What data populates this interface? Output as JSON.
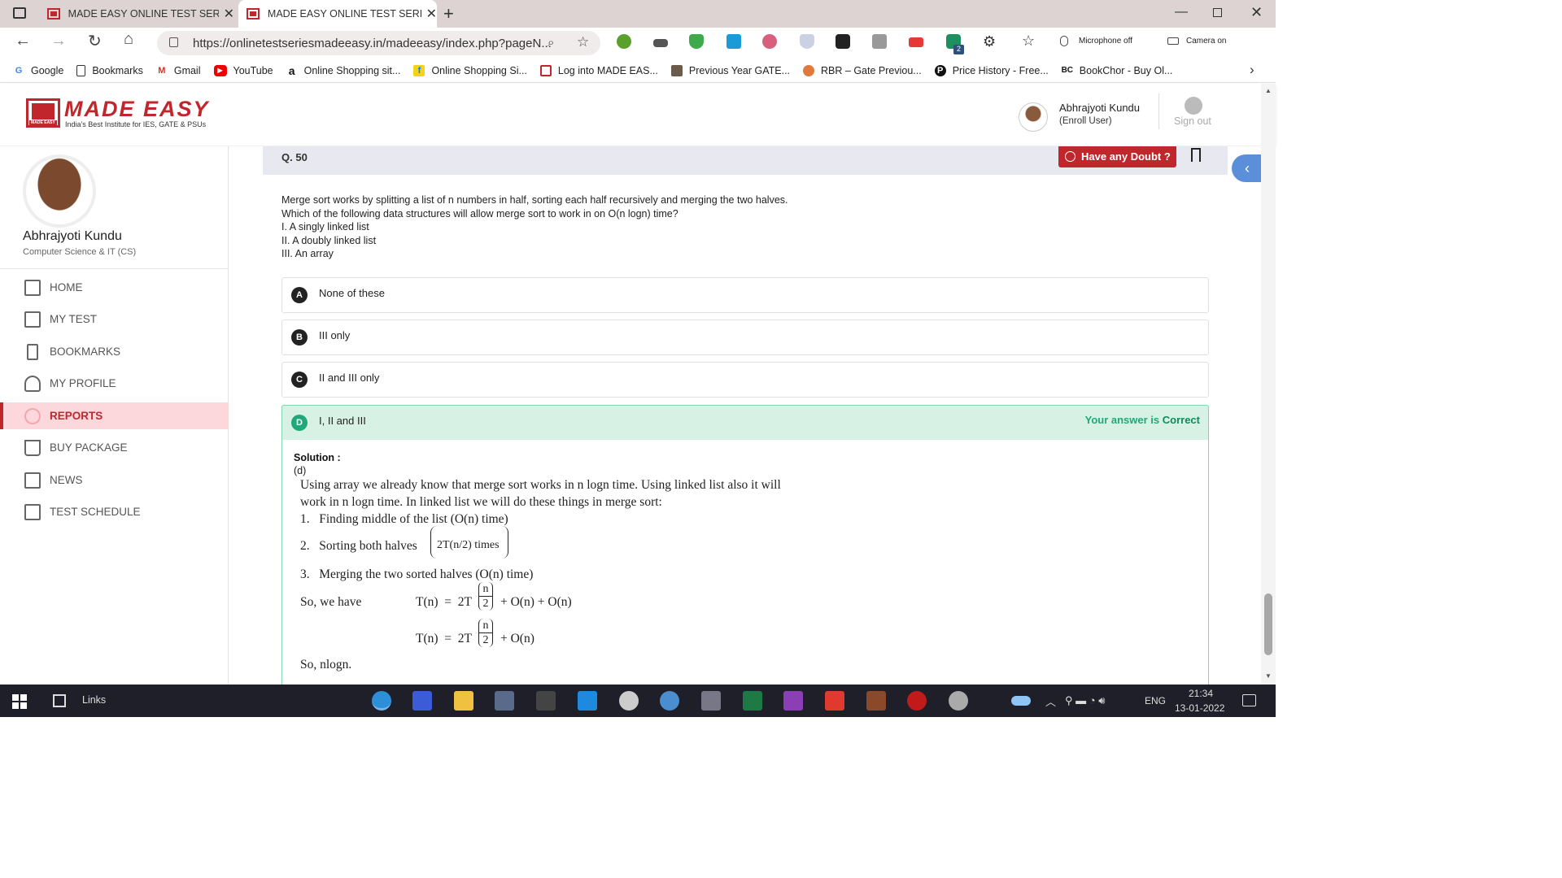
{
  "browser": {
    "tabs": [
      {
        "title": "MADE EASY ONLINE TEST SERIES",
        "active": false
      },
      {
        "title": "MADE EASY ONLINE TEST SERIES",
        "active": true
      }
    ],
    "url": "https://onlinetestseriesmadeeasy.in/madeeasy/index.php?pageN...",
    "mic_status": "Microphone off",
    "camera_status": "Camera on",
    "ext_badge": "2",
    "bookmarks": [
      {
        "label": "Google",
        "icon": "google-icon"
      },
      {
        "label": "Bookmarks",
        "icon": "page-icon"
      },
      {
        "label": "Gmail",
        "icon": "gmail-icon"
      },
      {
        "label": "YouTube",
        "icon": "youtube-icon"
      },
      {
        "label": "Online Shopping sit...",
        "icon": "amazon-icon"
      },
      {
        "label": "Online Shopping Si...",
        "icon": "flipkart-icon"
      },
      {
        "label": "Log into MADE EAS...",
        "icon": "madeeasy-icon"
      },
      {
        "label": "Previous Year GATE...",
        "icon": "gate-icon"
      },
      {
        "label": "RBR – Gate Previou...",
        "icon": "rbr-icon"
      },
      {
        "label": "Price History - Free...",
        "icon": "pricehistory-icon"
      },
      {
        "label": "BookChor - Buy Ol...",
        "icon": "bookchor-icon"
      }
    ]
  },
  "header": {
    "logo_text": "MADE EASY",
    "logo_tagline": "India's Best Institute for IES, GATE & PSUs",
    "logo_small": "MADE EASY",
    "user_name": "Abhrajyoti Kundu",
    "user_role": "(Enroll User)",
    "signout": "Sign out"
  },
  "sidebar": {
    "profile_name": "Abhrajyoti Kundu",
    "profile_branch": "Computer Science & IT (CS)",
    "items": [
      {
        "label": "HOME",
        "icon": "home-icon",
        "active": false
      },
      {
        "label": "MY TEST",
        "icon": "test-icon",
        "active": false
      },
      {
        "label": "BOOKMARKS",
        "icon": "bookmark-icon",
        "active": false
      },
      {
        "label": "MY PROFILE",
        "icon": "user-icon",
        "active": false
      },
      {
        "label": "REPORTS",
        "icon": "reports-icon",
        "active": true
      },
      {
        "label": "BUY PACKAGE",
        "icon": "cart-icon",
        "active": false
      },
      {
        "label": "NEWS",
        "icon": "news-icon",
        "active": false
      },
      {
        "label": "TEST SCHEDULE",
        "icon": "schedule-icon",
        "active": false
      }
    ]
  },
  "question": {
    "number": "Q. 50",
    "doubt_button": "Have any Doubt ?",
    "lines": [
      "Merge sort works by splitting a list of n numbers in half, sorting each half recursively and merging the two halves.",
      "Which of the following data structures will allow merge sort to work in on O(n logn) time?",
      "I. A singly linked list",
      "II. A doubly linked list",
      "III. An array"
    ],
    "options": [
      {
        "letter": "A",
        "text": "None of these"
      },
      {
        "letter": "B",
        "text": "III only"
      },
      {
        "letter": "C",
        "text": "II and III only"
      },
      {
        "letter": "D",
        "text": "I, II and III"
      }
    ],
    "result_prefix": "Your answer is",
    "result_word": "Correct",
    "solution_label": "Solution :",
    "solution_answer": "(d)",
    "solution_lines": [
      "Using array we already know that merge sort works in n logn time. Using linked list also it will",
      "work in n logn time. In linked list we will do these things in merge sort:"
    ],
    "steps": [
      "1.   Finding middle of the list (O(n) time)",
      "2.   Sorting both halves",
      "3.   Merging the two sorted halves (O(n) time)"
    ],
    "step2_math": "2T(n/2) times",
    "so_we_have": "So, we have",
    "eq1_lhs": "T(n)  =  2T",
    "eq1_rhs": "+ O(n) + O(n)",
    "eq2_lhs": "T(n)  =  2T",
    "eq2_rhs": "+ O(n)",
    "frac_num": "n",
    "frac_den": "2",
    "conclusion": "So, nlogn."
  },
  "taskbar": {
    "links_label": "Links",
    "lang": "ENG",
    "time": "21:34",
    "date": "13-01-2022"
  },
  "colors": {
    "brand": "#c0272d",
    "correct": "#1fa97a",
    "active_nav_bg": "#fcd7dc"
  }
}
